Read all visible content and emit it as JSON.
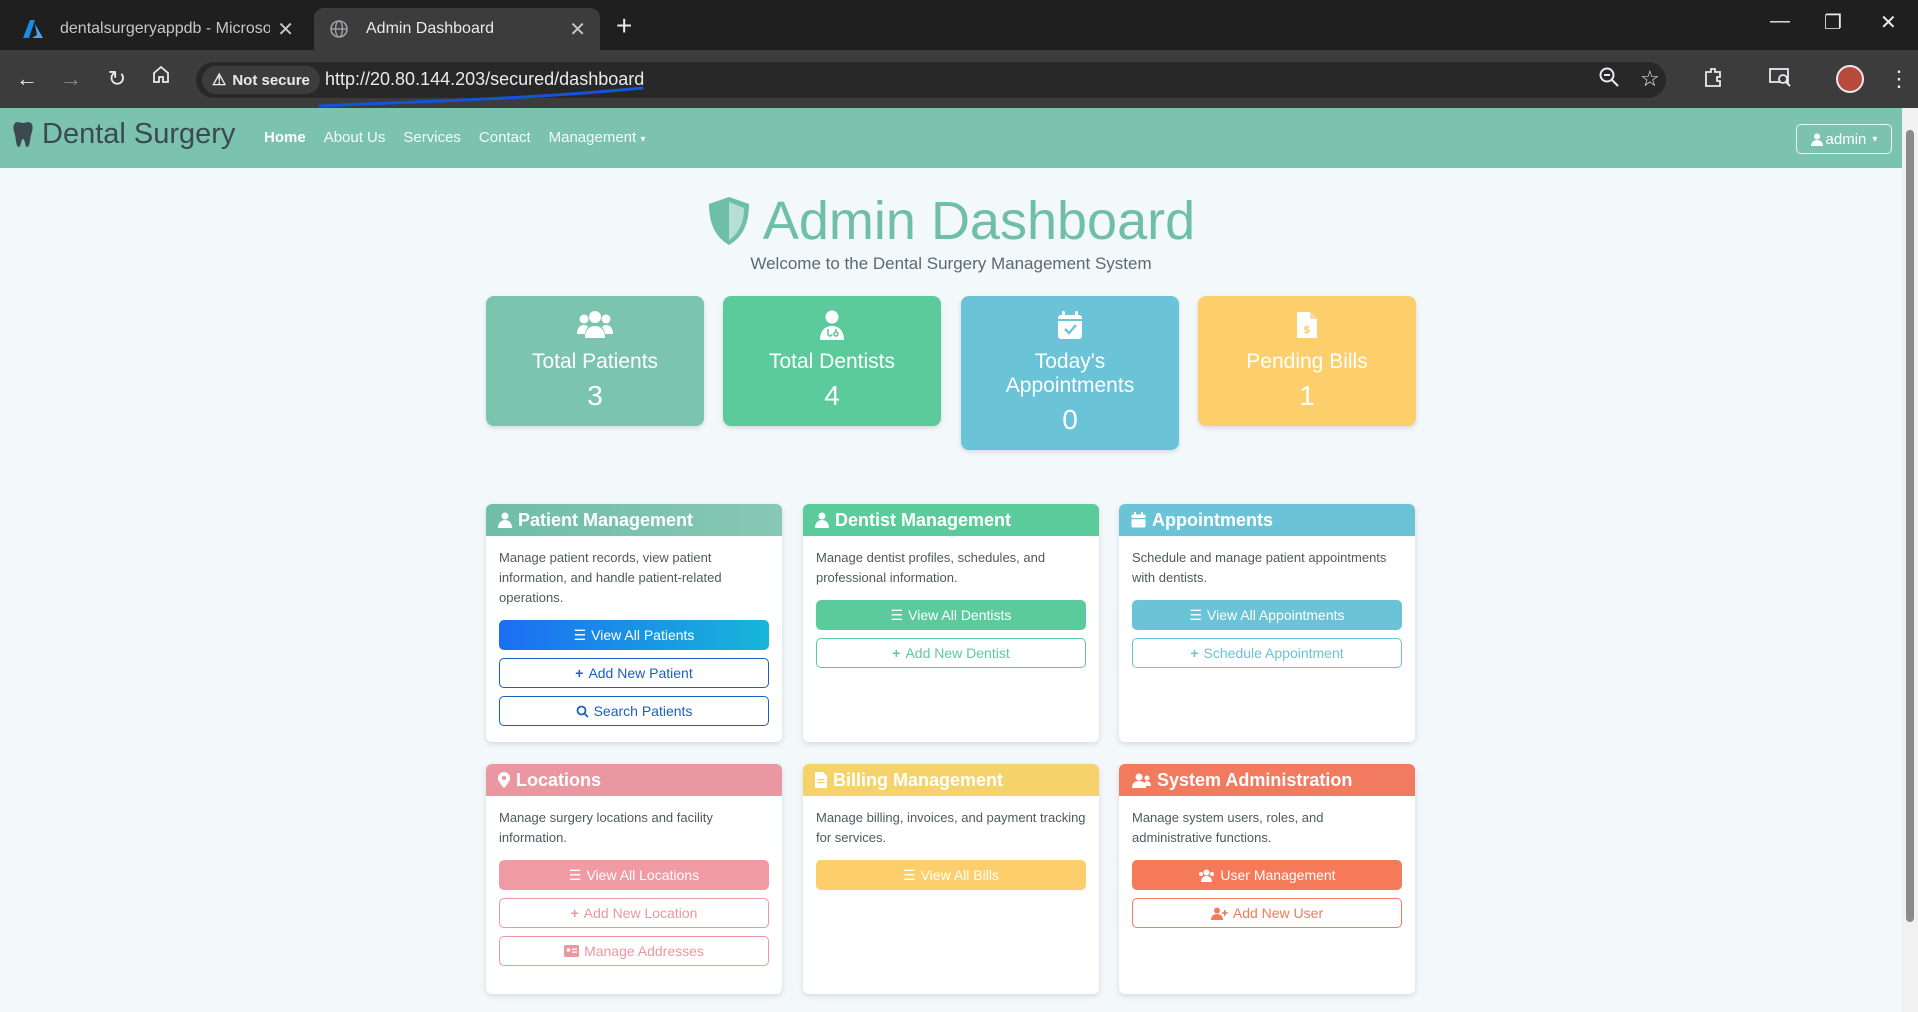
{
  "browser": {
    "tabs": [
      {
        "title": "dentalsurgeryappdb - Microsoft"
      },
      {
        "title": "Admin Dashboard"
      }
    ],
    "security_label": "Not secure",
    "url": "http://20.80.144.203/secured/dashboard"
  },
  "nav": {
    "brand": "Dental Surgery",
    "links": [
      "Home",
      "About Us",
      "Services",
      "Contact",
      "Management"
    ],
    "user": "admin"
  },
  "header": {
    "title": "Admin Dashboard",
    "subtitle": "Welcome to the Dental Surgery Management System"
  },
  "stats": [
    {
      "label": "Total Patients",
      "value": "3",
      "color": "#7bc4ae",
      "icon": "users-icon"
    },
    {
      "label": "Total Dentists",
      "value": "4",
      "color": "#5ccb9b",
      "icon": "dentist-icon"
    },
    {
      "label": "Today's Appointments",
      "value": "0",
      "color": "#6ac3d6",
      "icon": "calendar-check-icon"
    },
    {
      "label": "Pending Bills",
      "value": "1",
      "color": "#fccf6c",
      "icon": "invoice-icon"
    }
  ],
  "cards": [
    {
      "title": "Patient Management",
      "color": "#7bc4ae",
      "icon": "patient-icon",
      "description": "Manage patient records, view patient information, and handle patient-related operations.",
      "buttons": [
        "View All Patients",
        "Add New Patient",
        "Search Patients"
      ]
    },
    {
      "title": "Dentist Management",
      "color": "#5ccb9b",
      "icon": "dentist-icon",
      "description": "Manage dentist profiles, schedules, and professional information.",
      "buttons": [
        "View All Dentists",
        "Add New Dentist"
      ]
    },
    {
      "title": "Appointments",
      "color": "#6ac3d6",
      "icon": "calendar-icon",
      "description": "Schedule and manage patient appointments with dentists.",
      "buttons": [
        "View All Appointments",
        "Schedule Appointment"
      ]
    },
    {
      "title": "Locations",
      "color": "#eb97a2",
      "icon": "map-pin-icon",
      "description": "Manage surgery locations and facility information.",
      "buttons": [
        "View All Locations",
        "Add New Location",
        "Manage Addresses"
      ]
    },
    {
      "title": "Billing Management",
      "color": "#f6d26b",
      "icon": "invoice-icon",
      "description": "Manage billing, invoices, and payment tracking for services.",
      "buttons": [
        "View All Bills"
      ]
    },
    {
      "title": "System Administration",
      "color": "#f27a5e",
      "icon": "users-cog-icon",
      "description": "Manage system users, roles, and administrative functions.",
      "buttons": [
        "User Management",
        "Add New User"
      ]
    }
  ]
}
